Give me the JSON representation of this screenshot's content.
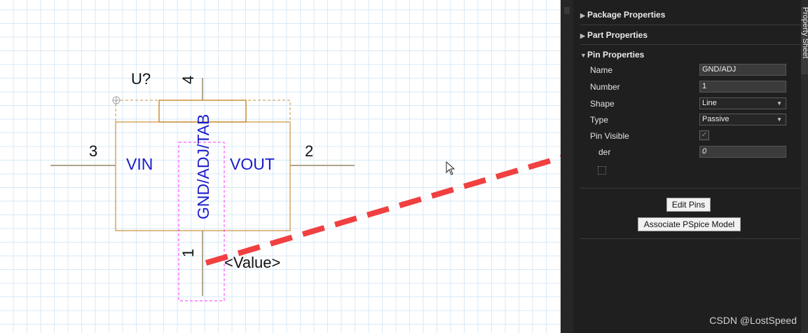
{
  "schematic": {
    "ref_designator": "U?",
    "value_label": "<Value>",
    "pins": [
      {
        "number": "4",
        "name": ""
      },
      {
        "number": "3",
        "name": "VIN"
      },
      {
        "number": "2",
        "name": "VOUT"
      },
      {
        "number": "1",
        "name": "GND/ADJ"
      }
    ],
    "pin1_name_full": "GND/ADJ/TAB",
    "colors": {
      "body": "#c8913c",
      "pin_name": "#1c1ccc",
      "selection": "#ff33ff",
      "wire": "#b2a58a",
      "arrow": "#f04040"
    }
  },
  "property_sheet": {
    "tab_label": "Property Sheet",
    "sections": {
      "package": "Package Properties",
      "part": "Part Properties",
      "pin": "Pin Properties"
    },
    "pin_props": {
      "name_label": "Name",
      "name_value": "GND/ADJ",
      "number_label": "Number",
      "number_value": "1",
      "shape_label": "Shape",
      "shape_value": "Line",
      "type_label": "Type",
      "type_value": "Passive",
      "visible_label": "Pin Visible",
      "order_label": "der",
      "order_value": "0"
    },
    "buttons": {
      "edit_pins": "Edit Pins",
      "associate": "Associate PSpice Model"
    }
  },
  "watermark": "CSDN @LostSpeed"
}
